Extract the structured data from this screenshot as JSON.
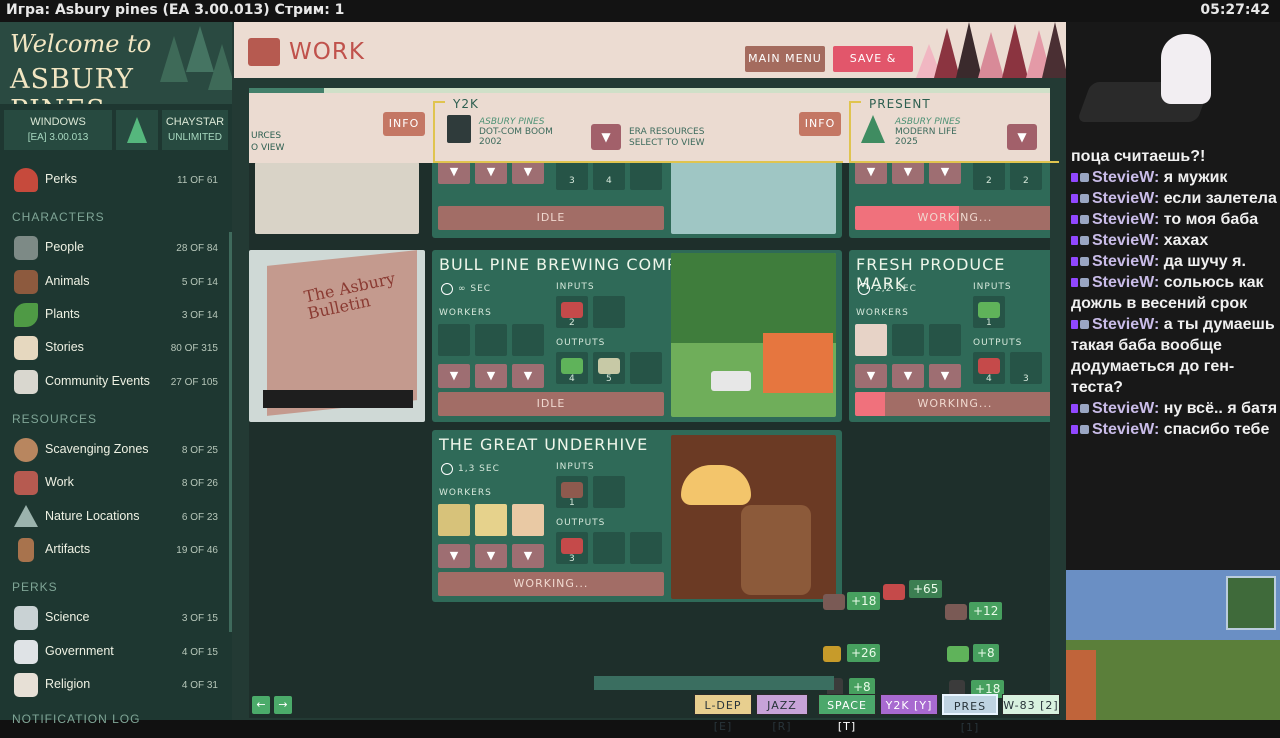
{
  "topbar": {
    "title": "Игра:  Asbury pines (EA 3.00.013)  Стрим: 1",
    "time": "05:27:42"
  },
  "sidebar": {
    "logo_welcome": "Welcome to",
    "logo_name": "ASBURY PINES",
    "platform": "WINDOWS",
    "version": "[EA] 3.00.013",
    "mode": "CHAYSTAR",
    "mode_sub": "UNLIMITED",
    "top_item": {
      "label": "Perks",
      "count": "11 OF 61"
    },
    "sections": {
      "characters": "CHARACTERS",
      "resources": "RESOURCES",
      "perks": "PERKS",
      "log": "NOTIFICATION LOG"
    },
    "characters": [
      {
        "label": "People",
        "count": "28 OF 84"
      },
      {
        "label": "Animals",
        "count": "5 OF 14"
      },
      {
        "label": "Plants",
        "count": "3 OF 14"
      },
      {
        "label": "Stories",
        "count": "80 OF 315"
      },
      {
        "label": "Community Events",
        "count": "27 OF 105"
      }
    ],
    "resources": [
      {
        "label": "Scavenging Zones",
        "count": "8 OF 25"
      },
      {
        "label": "Work",
        "count": "8 OF 26"
      },
      {
        "label": "Nature Locations",
        "count": "6 OF 23"
      },
      {
        "label": "Artifacts",
        "count": "19 OF 46"
      }
    ],
    "perks": [
      {
        "label": "Science",
        "count": "3 OF 15"
      },
      {
        "label": "Government",
        "count": "4 OF 15"
      },
      {
        "label": "Religion",
        "count": "4 OF 31"
      }
    ]
  },
  "header": {
    "title": "WORK",
    "main_menu": "MAIN MENU",
    "save_quit": "SAVE & QUIT"
  },
  "eras": [
    {
      "info": "INFO",
      "name": "Y2K",
      "town": "ASBURY PINES",
      "era": "DOT-COM BOOM",
      "year": "2002",
      "select_line1": "ERA RESOURCES",
      "select_line2": "SELECT TO VIEW"
    },
    {
      "info": "INFO",
      "name": "PRESENT",
      "town": "ASBURY PINES",
      "era": "MODERN LIFE",
      "year": "2025"
    }
  ],
  "era_left_cut": {
    "line1": "URCES",
    "line2": "O VIEW"
  },
  "labels": {
    "workers": "WORKERS",
    "inputs": "INPUTS",
    "outputs": "OUTPUTS",
    "arrow": "▼"
  },
  "cards": {
    "top_middle": {
      "status": "IDLE",
      "out1": "3",
      "out2": "4"
    },
    "top_right": {
      "status": "WORKING...",
      "c1": "2",
      "c2": "2"
    },
    "brewing": {
      "title": "BULL PINE BREWING COMPANY",
      "time": "∞ SEC",
      "in1": "2",
      "out1": "4",
      "out2": "5",
      "status": "IDLE"
    },
    "produce": {
      "title": "FRESH PRODUCE MARK",
      "time": "2,2 SEC",
      "in1": "1",
      "out1": "4",
      "out2": "3",
      "status": "WORKING...",
      "progress": 0.15
    },
    "underhive": {
      "title": "THE GREAT UNDERHIVE",
      "time": "1,3 SEC",
      "in1": "1",
      "out1": "3",
      "status": "WORKING..."
    },
    "bulletin": {
      "sign": "The Asbury Bulletin"
    }
  },
  "gains": [
    "+65",
    "+18",
    "+12",
    "+26",
    "+8",
    "+8",
    "+18"
  ],
  "speeds": [
    "L-DEP [E]",
    "JAZZ [R]",
    "SPACE [T]",
    "Y2K [Y]",
    "PRES [1]",
    "W-83 [2]"
  ],
  "nav_arrows": {
    "prev": "←",
    "next": "→"
  },
  "chat": {
    "top_cut": "поца считаешь?!",
    "user": "StevieW:",
    "messages": [
      "я мужик",
      "если залетела",
      "то моя баба",
      "хахах",
      "да шучу я.",
      "сольюсь как дожль в весений срок",
      "а ты думаешь такая баба вообще додумаеться до ген-теста?",
      "ну всё.. я батя",
      "спасибо тебе"
    ]
  },
  "colors": {
    "accent_red": "#e2566b",
    "panel_green": "#2f6a58",
    "sidebar_bg": "#1e3731"
  }
}
